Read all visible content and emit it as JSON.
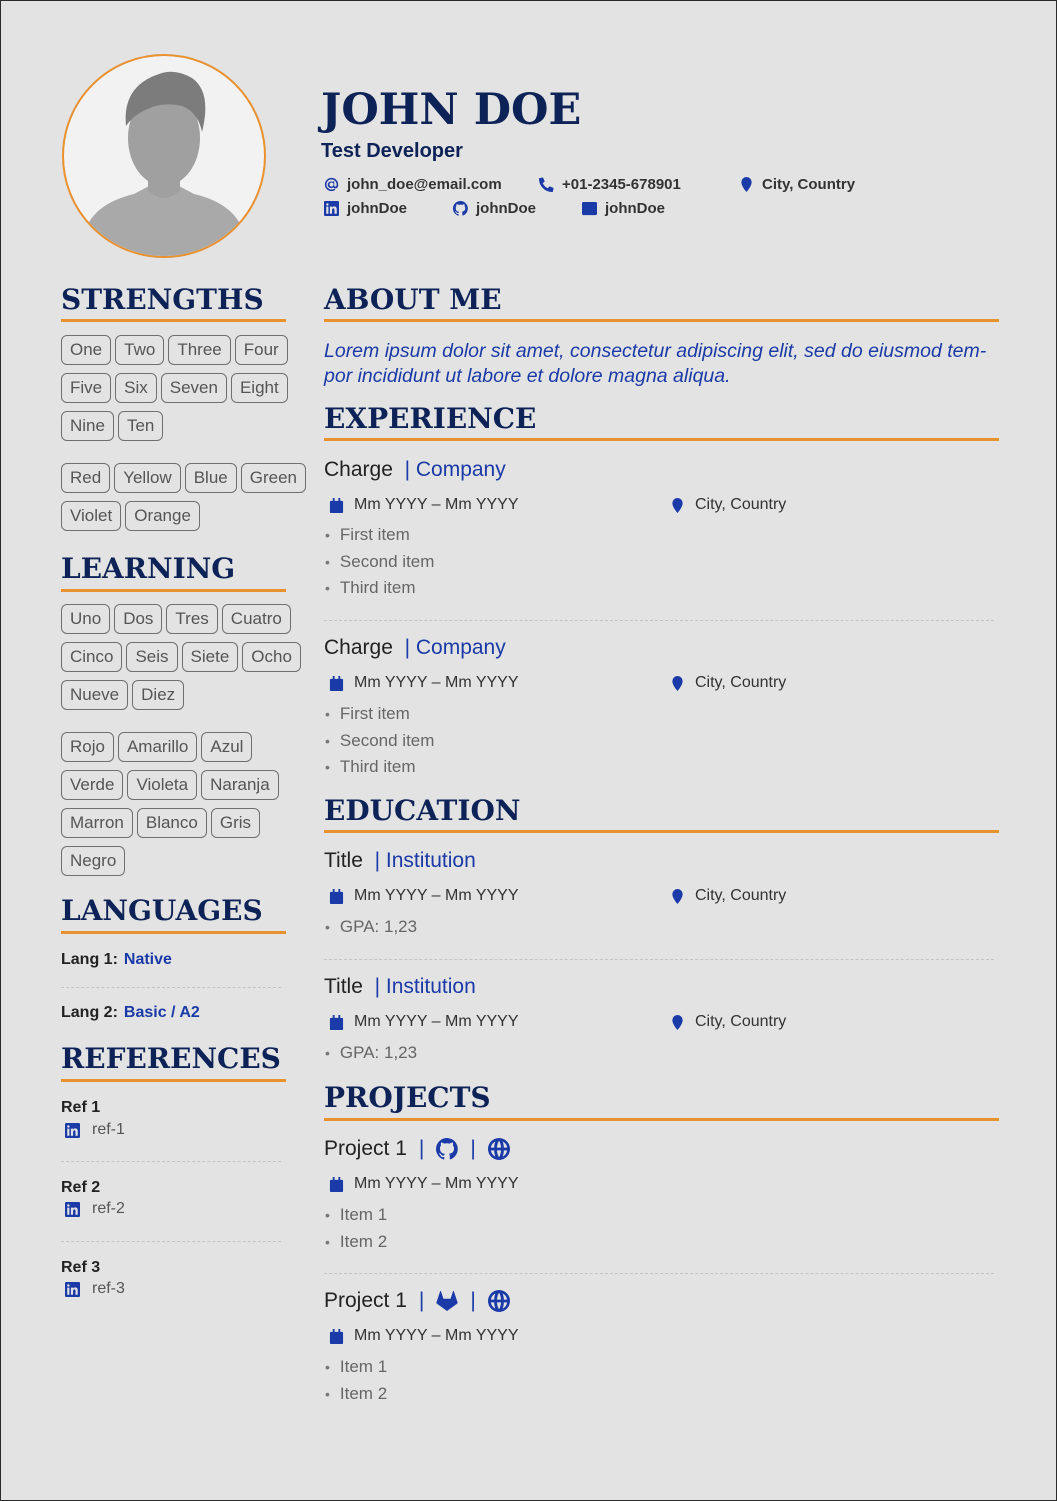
{
  "header": {
    "name": "JOHN DOE",
    "role": "Test Developer",
    "email": "john_doe@email.com",
    "phone": "+01-2345-678901",
    "location": "City, Country",
    "linkedin": "johnDoe",
    "github": "johnDoe",
    "devto": "johnDoe",
    "devto_badge": "DEV"
  },
  "sections": {
    "strengths": "STRENGTHS",
    "learning": "LEARNING",
    "languages": "LANGUAGES",
    "references": "REFERENCES",
    "about": "ABOUT ME",
    "experience": "EXPERIENCE",
    "education": "EDUCATION",
    "projects": "PROJECTS"
  },
  "strengths": {
    "group1": [
      "One",
      "Two",
      "Three",
      "Four",
      "Five",
      "Six",
      "Seven",
      "Eight",
      "Nine",
      "Ten"
    ],
    "group2": [
      "Red",
      "Yellow",
      "Blue",
      "Green",
      "Violet",
      "Orange"
    ]
  },
  "learning": {
    "group1": [
      "Uno",
      "Dos",
      "Tres",
      "Cuatro",
      "Cinco",
      "Seis",
      "Siete",
      "Ocho",
      "Nueve",
      "Diez"
    ],
    "group2": [
      "Rojo",
      "Amarillo",
      "Azul",
      "Verde",
      "Violeta",
      "Naranja",
      "Marron",
      "Blanco",
      "Gris",
      "Negro"
    ]
  },
  "languages": [
    {
      "label": "Lang 1:",
      "level": "Native"
    },
    {
      "label": "Lang 2:",
      "level": "Basic / A2"
    }
  ],
  "references": [
    {
      "name": "Ref 1",
      "link": "ref-1"
    },
    {
      "name": "Ref 2",
      "link": "ref-2"
    },
    {
      "name": "Ref 3",
      "link": "ref-3"
    }
  ],
  "about": "Lorem ipsum dolor sit amet, consectetur adipiscing elit, sed do eiusmod tem-por incididunt ut labore et dolore magna aliqua.",
  "about_lines": [
    "Lorem ipsum dolor sit amet, consectetur adipiscing elit, sed do eiusmod tem-",
    "por incididunt ut labore et dolore magna aliqua."
  ],
  "experience": [
    {
      "title": "Charge",
      "org": "| Company",
      "dates": "Mm YYYY – Mm YYYY",
      "location": "City, Country",
      "items": [
        "First item",
        "Second item",
        "Third item"
      ]
    },
    {
      "title": "Charge",
      "org": "| Company",
      "dates": "Mm YYYY – Mm YYYY",
      "location": "City, Country",
      "items": [
        "First item",
        "Second item",
        "Third item"
      ]
    }
  ],
  "education": [
    {
      "title": "Title",
      "org": "| Institution",
      "dates": "Mm YYYY – Mm YYYY",
      "location": "City, Country",
      "items": [
        "GPA: 1,23"
      ]
    },
    {
      "title": "Title",
      "org": "| Institution",
      "dates": "Mm YYYY – Mm YYYY",
      "location": "City, Country",
      "items": [
        "GPA: 1,23"
      ]
    }
  ],
  "projects": [
    {
      "title": "Project 1",
      "repo_icon": "github-icon",
      "sep": "|",
      "dates": "Mm YYYY – Mm YYYY",
      "items": [
        "Item 1",
        "Item 2"
      ]
    },
    {
      "title": "Project 1",
      "repo_icon": "gitlab-icon",
      "sep": "|",
      "dates": "Mm YYYY – Mm YYYY",
      "items": [
        "Item 1",
        "Item 2"
      ]
    }
  ],
  "colors": {
    "navy": "#0d2257",
    "accent": "#e8912f",
    "link": "#1a3aa8",
    "page": "#e3e3e3"
  }
}
